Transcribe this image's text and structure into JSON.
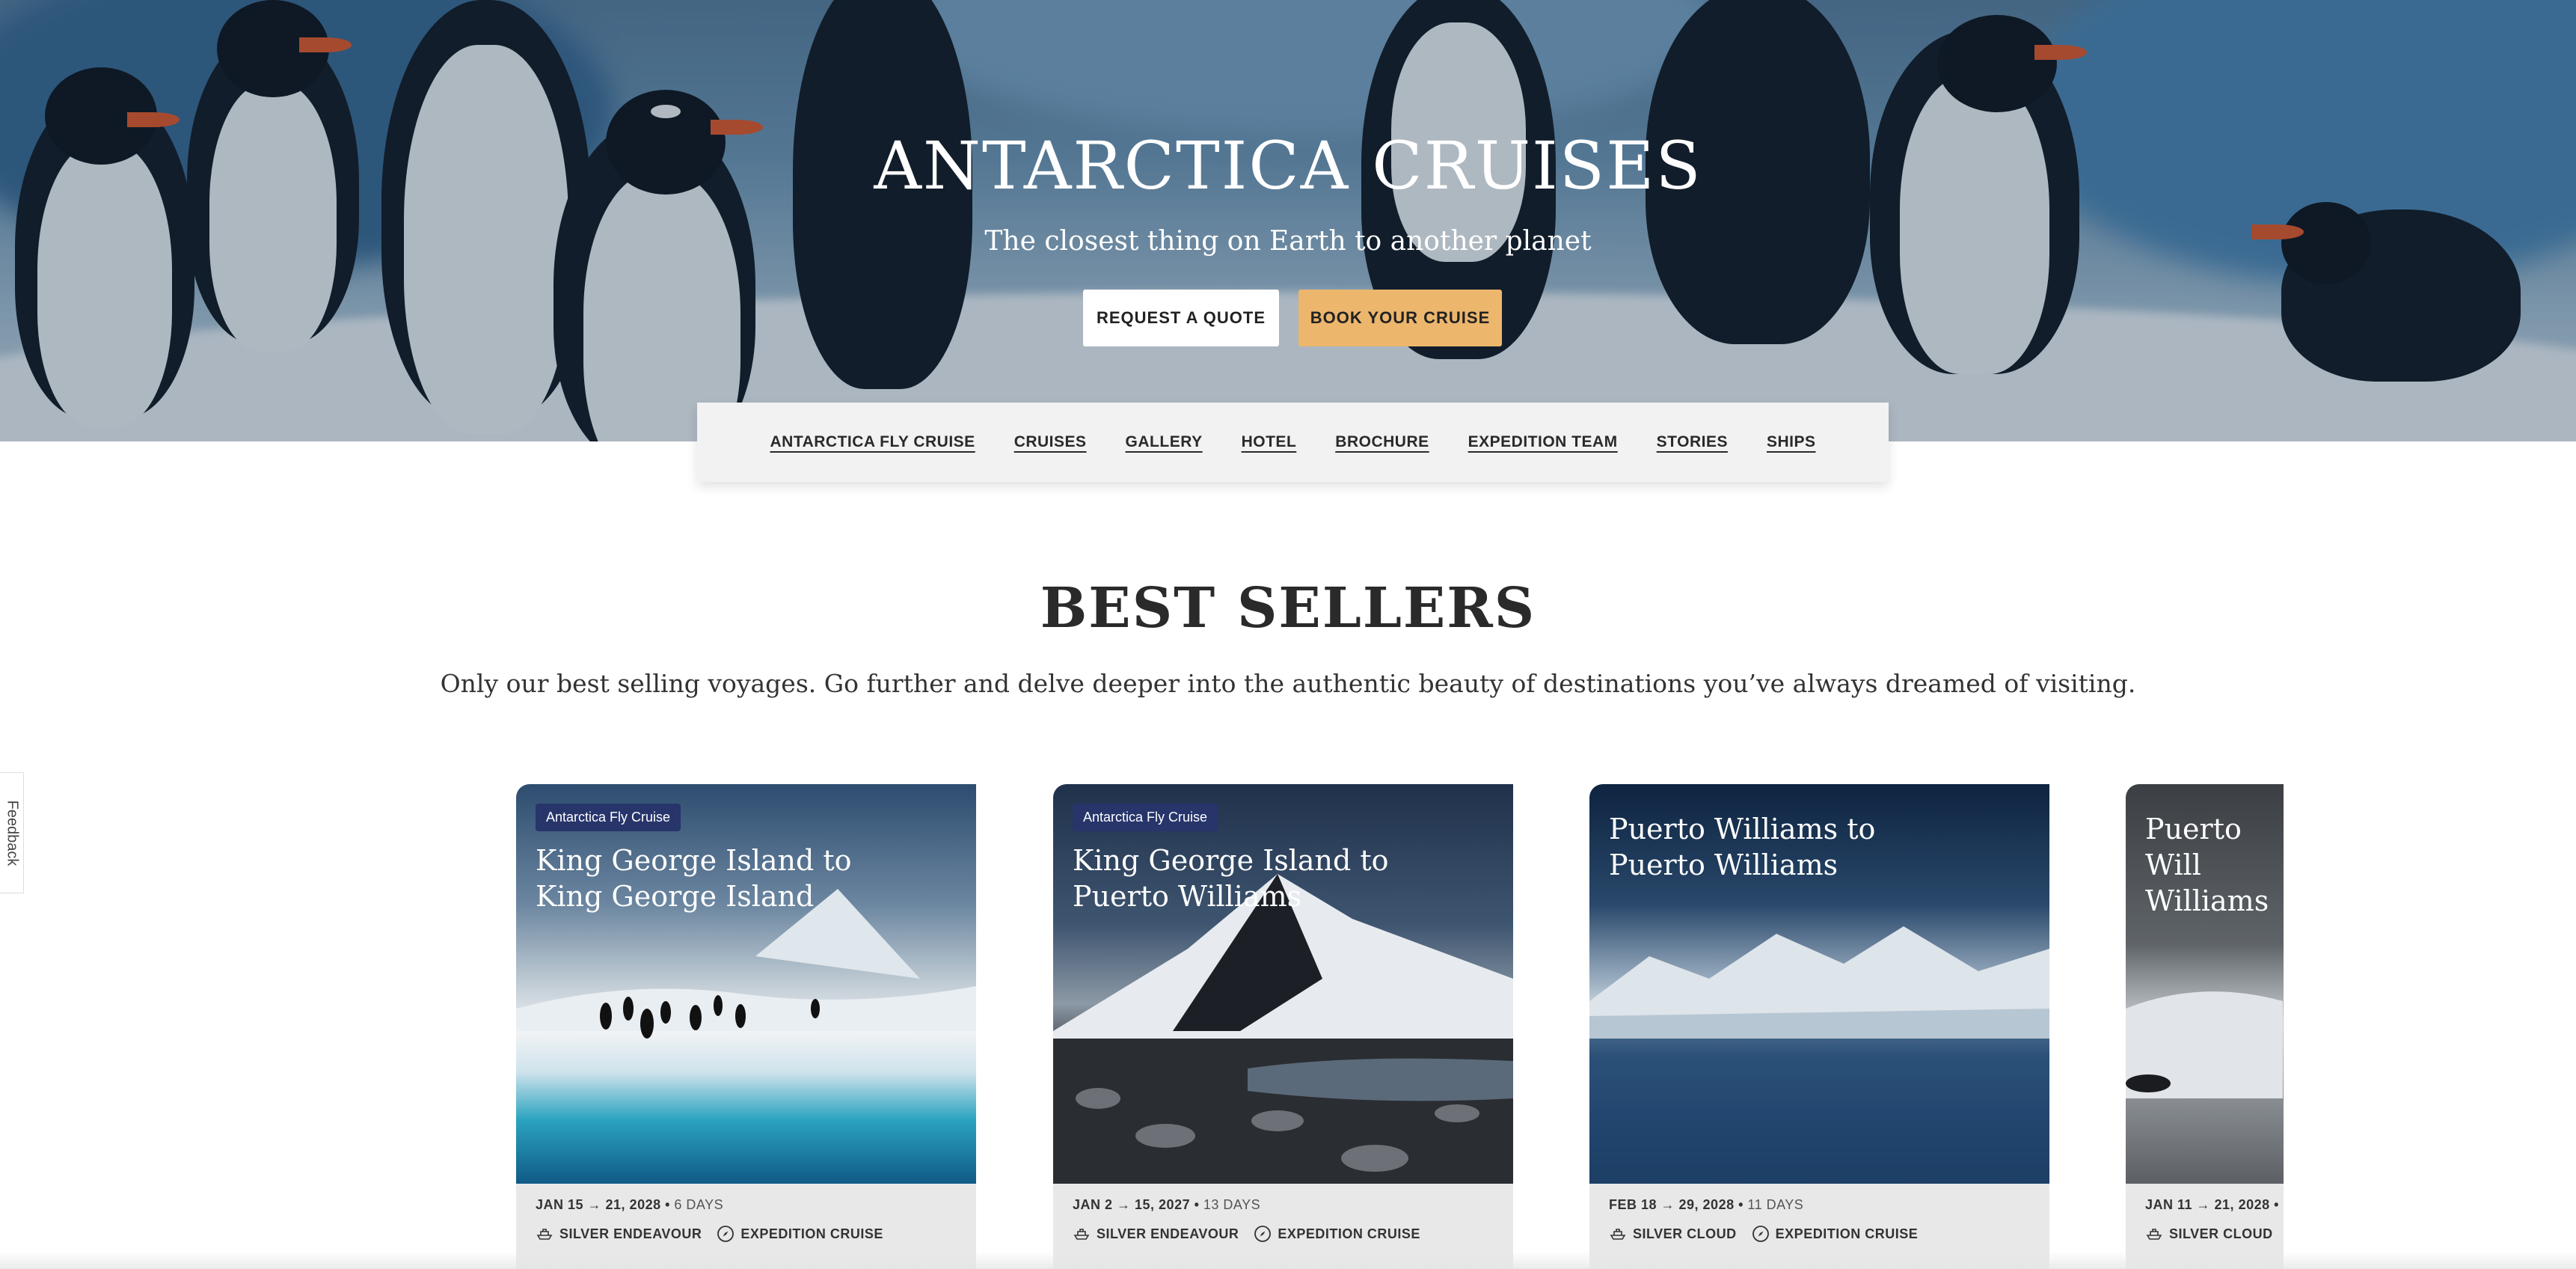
{
  "hero": {
    "title": "ANTARCTICA CRUISES",
    "subtitle": "The closest thing on Earth to another planet",
    "request_quote_label": "REQUEST A QUOTE",
    "book_cruise_label": "BOOK YOUR CRUISE"
  },
  "colors": {
    "accent_button": "#ecb66d",
    "tag_background": "#27356b"
  },
  "nav": {
    "items": [
      {
        "label": "ANTARCTICA FLY CRUISE"
      },
      {
        "label": "CRUISES"
      },
      {
        "label": "GALLERY"
      },
      {
        "label": "HOTEL"
      },
      {
        "label": "BROCHURE"
      },
      {
        "label": "EXPEDITION TEAM"
      },
      {
        "label": "STORIES"
      },
      {
        "label": "SHIPS"
      }
    ]
  },
  "best_sellers": {
    "title": "BEST SELLERS",
    "subtitle": "Only our best selling voyages. Go further and delve deeper into the authentic beauty of destinations you’ve always dreamed of visiting."
  },
  "feedback_label": "Feedback",
  "cards": [
    {
      "tag": "Antarctica Fly Cruise",
      "title": "King George Island to King George Island",
      "dates": "JAN 15 → 21, 2028",
      "duration": "6 DAYS",
      "ship": "SILVER ENDEAVOUR",
      "cruise_type": "EXPEDITION CRUISE",
      "ship_icon": "ship-icon",
      "type_icon": "compass-icon"
    },
    {
      "tag": "Antarctica Fly Cruise",
      "title": "King George Island to Puerto Williams",
      "dates": "JAN 2 → 15, 2027",
      "duration": "13 DAYS",
      "ship": "SILVER ENDEAVOUR",
      "cruise_type": "EXPEDITION CRUISE",
      "ship_icon": "ship-icon",
      "type_icon": "compass-icon"
    },
    {
      "title": "Puerto Williams to Puerto Williams",
      "dates": "FEB 18 → 29, 2028",
      "duration": "11 DAYS",
      "ship": "SILVER CLOUD",
      "cruise_type": "EXPEDITION CRUISE",
      "ship_icon": "ship-icon",
      "type_icon": "compass-icon"
    },
    {
      "title_visible": "Puerto Will Williams",
      "dates_visible": "JAN 11 → 21, 2028 •",
      "ship": "SILVER CLOUD",
      "ship_icon": "ship-icon"
    }
  ]
}
